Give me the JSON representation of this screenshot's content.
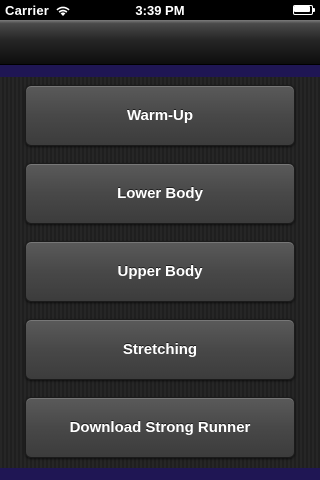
{
  "status_bar": {
    "carrier": "Carrier",
    "time": "3:39 PM",
    "wifi_icon": "wifi-icon",
    "battery_icon": "battery-icon"
  },
  "nav_bar": {
    "title": ""
  },
  "menu": {
    "items": [
      {
        "label": "Warm-Up"
      },
      {
        "label": "Lower Body"
      },
      {
        "label": "Upper Body"
      },
      {
        "label": "Stretching"
      },
      {
        "label": "Download Strong Runner"
      }
    ]
  },
  "colors": {
    "accent": "#1f1654",
    "button": "#4a4a4a",
    "background": "#1f1f1f"
  }
}
